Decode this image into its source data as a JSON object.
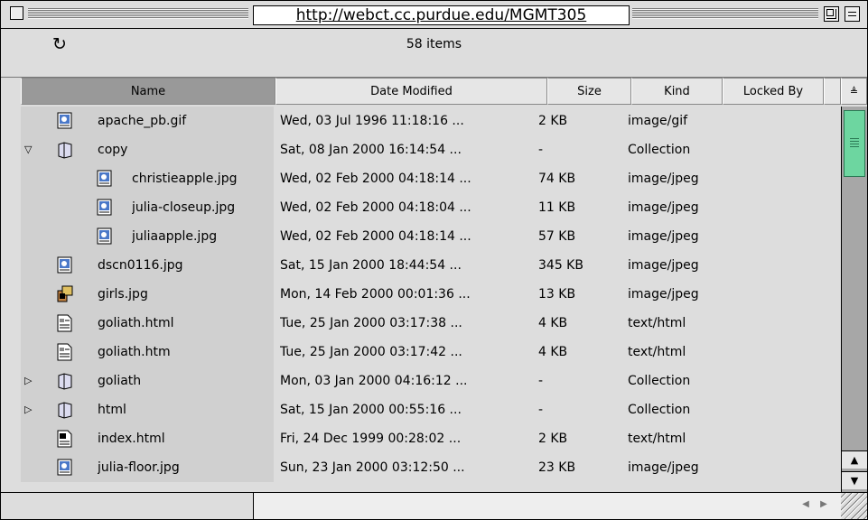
{
  "window": {
    "title": "http://webct.cc.purdue.edu/MGMT305",
    "item_count": "58 items"
  },
  "icons": {
    "refresh": "↻",
    "expanded": "▽",
    "collapsed": "▷",
    "scroll_up": "▲",
    "scroll_down": "▼",
    "scroll_left": "◀",
    "scroll_right": "▶",
    "column_sort": "≜"
  },
  "columns": {
    "name": "Name",
    "date": "Date Modified",
    "size": "Size",
    "kind": "Kind",
    "locked": "Locked By"
  },
  "rows": [
    {
      "name": "apache_pb.gif",
      "date": "Wed, 03 Jul 1996 11:18:16 ...",
      "size": "2 KB",
      "kind": "image/gif"
    },
    {
      "name": "copy",
      "date": "Sat, 08 Jan 2000 16:14:54 ...",
      "size": "-",
      "kind": "Collection"
    },
    {
      "name": "christieapple.jpg",
      "date": "Wed, 02 Feb 2000 04:18:14 ...",
      "size": "74 KB",
      "kind": "image/jpeg"
    },
    {
      "name": "julia-closeup.jpg",
      "date": "Wed, 02 Feb 2000 04:18:04 ...",
      "size": "11 KB",
      "kind": "image/jpeg"
    },
    {
      "name": "juliaapple.jpg",
      "date": "Wed, 02 Feb 2000 04:18:14 ...",
      "size": "57 KB",
      "kind": "image/jpeg"
    },
    {
      "name": "dscn0116.jpg",
      "date": "Sat, 15 Jan 2000 18:44:54 ...",
      "size": "345 KB",
      "kind": "image/jpeg"
    },
    {
      "name": "girls.jpg",
      "date": "Mon, 14 Feb 2000 00:01:36 ...",
      "size": "13 KB",
      "kind": "image/jpeg"
    },
    {
      "name": "goliath.html",
      "date": "Tue, 25 Jan 2000 03:17:38 ...",
      "size": "4 KB",
      "kind": "text/html"
    },
    {
      "name": "goliath.htm",
      "date": "Tue, 25 Jan 2000 03:17:42 ...",
      "size": "4 KB",
      "kind": "text/html"
    },
    {
      "name": "goliath",
      "date": "Mon, 03 Jan 2000 04:16:12 ...",
      "size": "-",
      "kind": "Collection"
    },
    {
      "name": "html",
      "date": "Sat, 15 Jan 2000 00:55:16 ...",
      "size": "-",
      "kind": "Collection"
    },
    {
      "name": "index.html",
      "date": "Fri, 24 Dec 1999 00:28:02 ...",
      "size": "2 KB",
      "kind": "text/html"
    },
    {
      "name": "julia-floor.jpg",
      "date": "Sun, 23 Jan 2000 03:12:50 ...",
      "size": "23 KB",
      "kind": "image/jpeg"
    }
  ]
}
